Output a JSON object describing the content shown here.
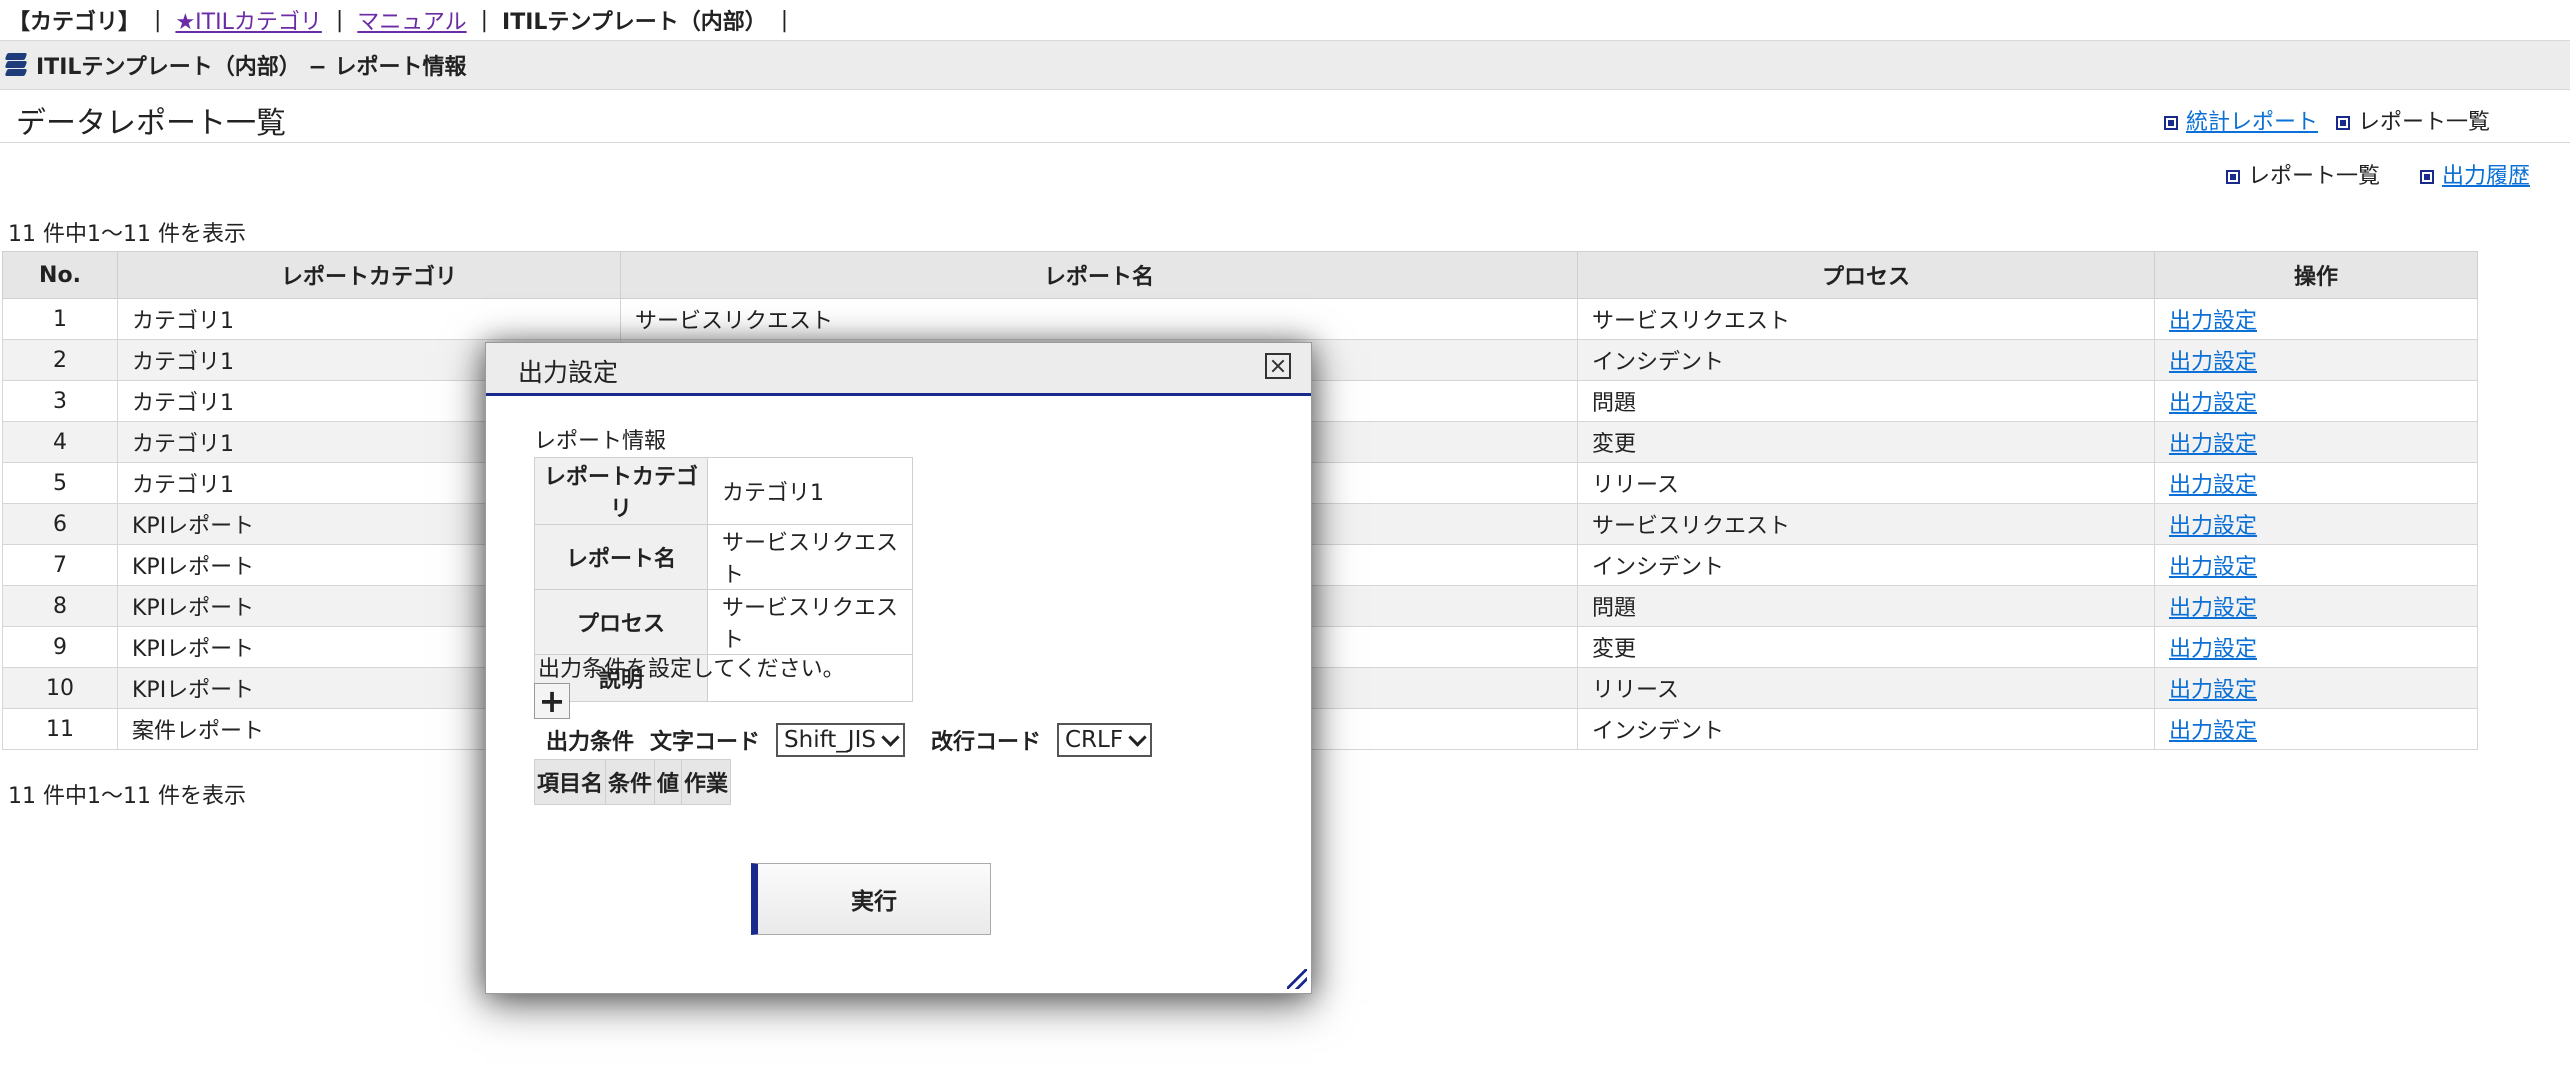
{
  "nav": {
    "category": "【カテゴリ】",
    "itil_category": "★ITILカテゴリ",
    "manual": "マニュアル",
    "template": "ITILテンプレート（内部）",
    "sep": "|"
  },
  "header": {
    "title": "ITILテンプレート（内部） − レポート情報"
  },
  "page": {
    "title": "データレポート一覧",
    "link_stats": "統計レポート",
    "link_list": "レポート一覧",
    "sub_list": "レポート一覧",
    "sub_history": "出力履歴",
    "count_top": "11 件中1〜11 件を表示",
    "count_bottom": "11 件中1〜11 件を表示"
  },
  "table": {
    "headers": [
      "No.",
      "レポートカテゴリ",
      "レポート名",
      "プロセス",
      "操作"
    ],
    "rows": [
      {
        "no": "1",
        "category": "カテゴリ1",
        "name": "サービスリクエスト",
        "process": "サービスリクエスト",
        "action": "出力設定"
      },
      {
        "no": "2",
        "category": "カテゴリ1",
        "name": "",
        "process": "インシデント",
        "action": "出力設定"
      },
      {
        "no": "3",
        "category": "カテゴリ1",
        "name": "",
        "process": "問題",
        "action": "出力設定"
      },
      {
        "no": "4",
        "category": "カテゴリ1",
        "name": "",
        "process": "変更",
        "action": "出力設定"
      },
      {
        "no": "5",
        "category": "カテゴリ1",
        "name": "",
        "process": "リリース",
        "action": "出力設定"
      },
      {
        "no": "6",
        "category": "KPIレポート",
        "name": "",
        "process": "サービスリクエスト",
        "action": "出力設定"
      },
      {
        "no": "7",
        "category": "KPIレポート",
        "name": "",
        "process": "インシデント",
        "action": "出力設定"
      },
      {
        "no": "8",
        "category": "KPIレポート",
        "name": "",
        "process": "問題",
        "action": "出力設定"
      },
      {
        "no": "9",
        "category": "KPIレポート",
        "name": "",
        "process": "変更",
        "action": "出力設定"
      },
      {
        "no": "10",
        "category": "KPIレポート",
        "name": "",
        "process": "リリース",
        "action": "出力設定"
      },
      {
        "no": "11",
        "category": "案件レポート",
        "name": "",
        "process": "インシデント",
        "action": "出力設定"
      }
    ]
  },
  "modal": {
    "title": "出力設定",
    "section": "レポート情報",
    "info": [
      {
        "label": "レポートカテゴリ",
        "value": "カテゴリ1"
      },
      {
        "label": "レポート名",
        "value": "サービスリクエスト"
      },
      {
        "label": "プロセス",
        "value": "サービスリクエスト"
      },
      {
        "label": "説明",
        "value": ""
      }
    ],
    "instruction": "出力条件を設定してください。",
    "plus": "+",
    "cond_label": "出力条件",
    "charcode_label": "文字コード",
    "charcode_value": "Shift_JIS",
    "newline_label": "改行コード",
    "newline_value": "CRLF",
    "cond_headers": [
      "項目名",
      "条件",
      "値",
      "作業"
    ],
    "run": "実行"
  },
  "colors": {
    "accent": "#1a2a8c",
    "link": "#0a6fd6",
    "visited": "#6b2aa6"
  }
}
